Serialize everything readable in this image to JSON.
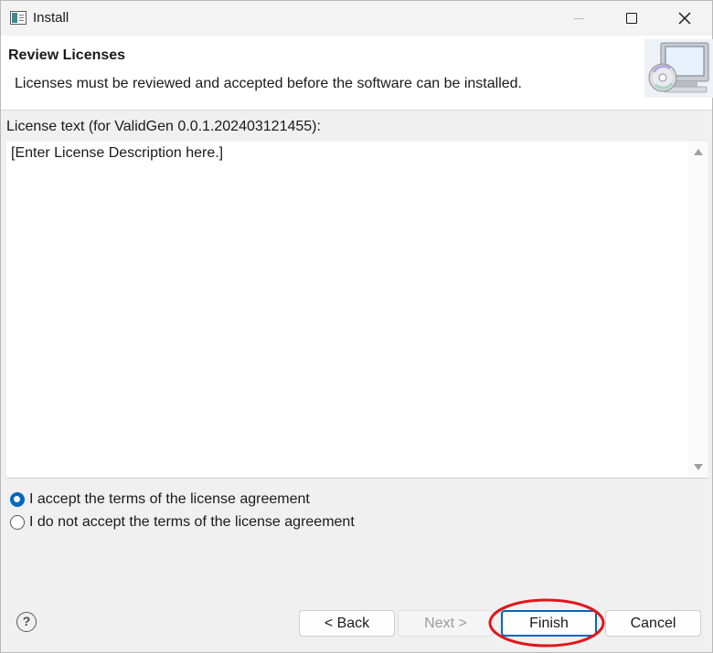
{
  "window": {
    "title": "Install"
  },
  "banner": {
    "title": "Review Licenses",
    "description": "Licenses must be reviewed and accepted before the software can be installed.",
    "icon": "cd-computer-icon"
  },
  "license": {
    "label": "License text (for ValidGen 0.0.1.202403121455):",
    "text": "[Enter License Description here.]"
  },
  "options": {
    "accept_label": "I accept the terms of the license agreement",
    "reject_label": "I do not accept the terms of the license agreement",
    "selected": "accept"
  },
  "footer": {
    "help_label": "?",
    "back_label": "< Back",
    "next_label": "Next >",
    "finish_label": "Finish",
    "cancel_label": "Cancel"
  },
  "colors": {
    "accent": "#0067c0",
    "annotation": "#e0161b"
  }
}
